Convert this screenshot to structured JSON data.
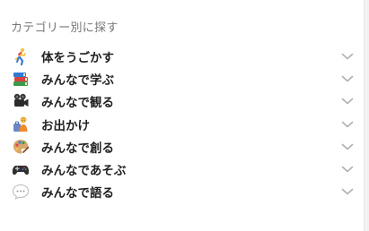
{
  "section": {
    "heading": "カテゴリー別に探す"
  },
  "categories": [
    {
      "label": "体をうごかす",
      "icon": "running-person-icon"
    },
    {
      "label": "みんなで学ぶ",
      "icon": "books-icon"
    },
    {
      "label": "みんなで観る",
      "icon": "movie-camera-icon"
    },
    {
      "label": "お出かけ",
      "icon": "person-with-luggage-icon"
    },
    {
      "label": "みんなで創る",
      "icon": "artist-palette-icon"
    },
    {
      "label": "みんなであそぶ",
      "icon": "game-controller-icon"
    },
    {
      "label": "みんなで語る",
      "icon": "speech-bubble-icon"
    }
  ],
  "colors": {
    "heading": "#777777",
    "label": "#222222",
    "chevron": "#b0b0b0"
  }
}
